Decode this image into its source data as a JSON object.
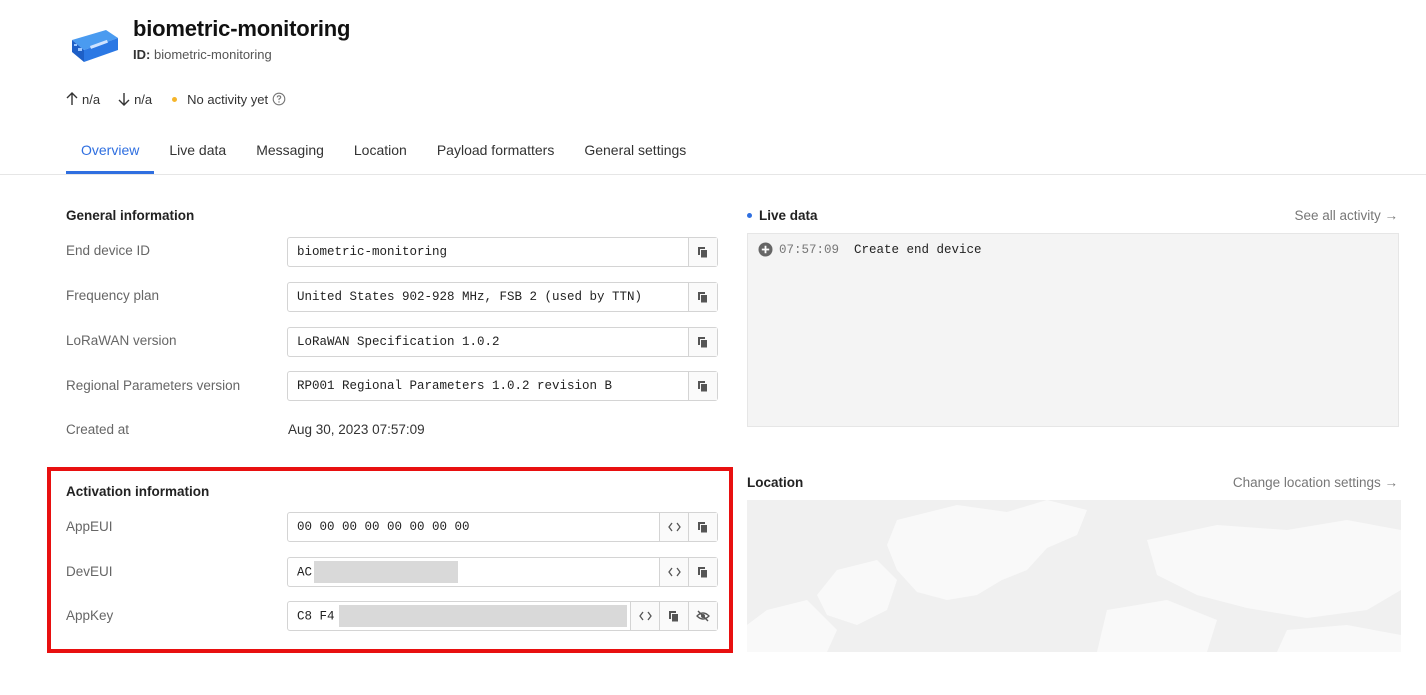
{
  "header": {
    "title": "biometric-monitoring",
    "id_label": "ID:",
    "id_value": "biometric-monitoring"
  },
  "stats": {
    "uplink": "n/a",
    "downlink": "n/a",
    "activity": "No activity yet",
    "activity_color": "#f5b52b"
  },
  "tabs": [
    {
      "label": "Overview",
      "active": true
    },
    {
      "label": "Live data"
    },
    {
      "label": "Messaging"
    },
    {
      "label": "Location"
    },
    {
      "label": "Payload formatters"
    },
    {
      "label": "General settings"
    }
  ],
  "general": {
    "title": "General information",
    "rows": [
      {
        "label": "End device ID",
        "value": "biometric-monitoring"
      },
      {
        "label": "Frequency plan",
        "value": "United States 902-928 MHz, FSB 2 (used by TTN)"
      },
      {
        "label": "LoRaWAN version",
        "value": "LoRaWAN Specification 1.0.2"
      },
      {
        "label": "Regional Parameters version",
        "value": "RP001 Regional Parameters 1.0.2 revision B"
      },
      {
        "label": "Created at",
        "value": "Aug 30, 2023 07:57:09"
      }
    ]
  },
  "activation": {
    "title": "Activation information",
    "rows": [
      {
        "label": "AppEUI",
        "value": "00 00 00 00 00 00 00 00"
      },
      {
        "label": "DevEUI",
        "value": "AC"
      },
      {
        "label": "AppKey",
        "value": "C8 F4"
      }
    ]
  },
  "live": {
    "title": "Live data",
    "link": "See all activity →",
    "events": [
      {
        "time": "07:57:09",
        "text": "Create end device"
      }
    ]
  },
  "location": {
    "title": "Location",
    "link": "Change location settings →"
  },
  "colors": {
    "accent": "#2f6fe0",
    "highlight": "#e81010"
  }
}
